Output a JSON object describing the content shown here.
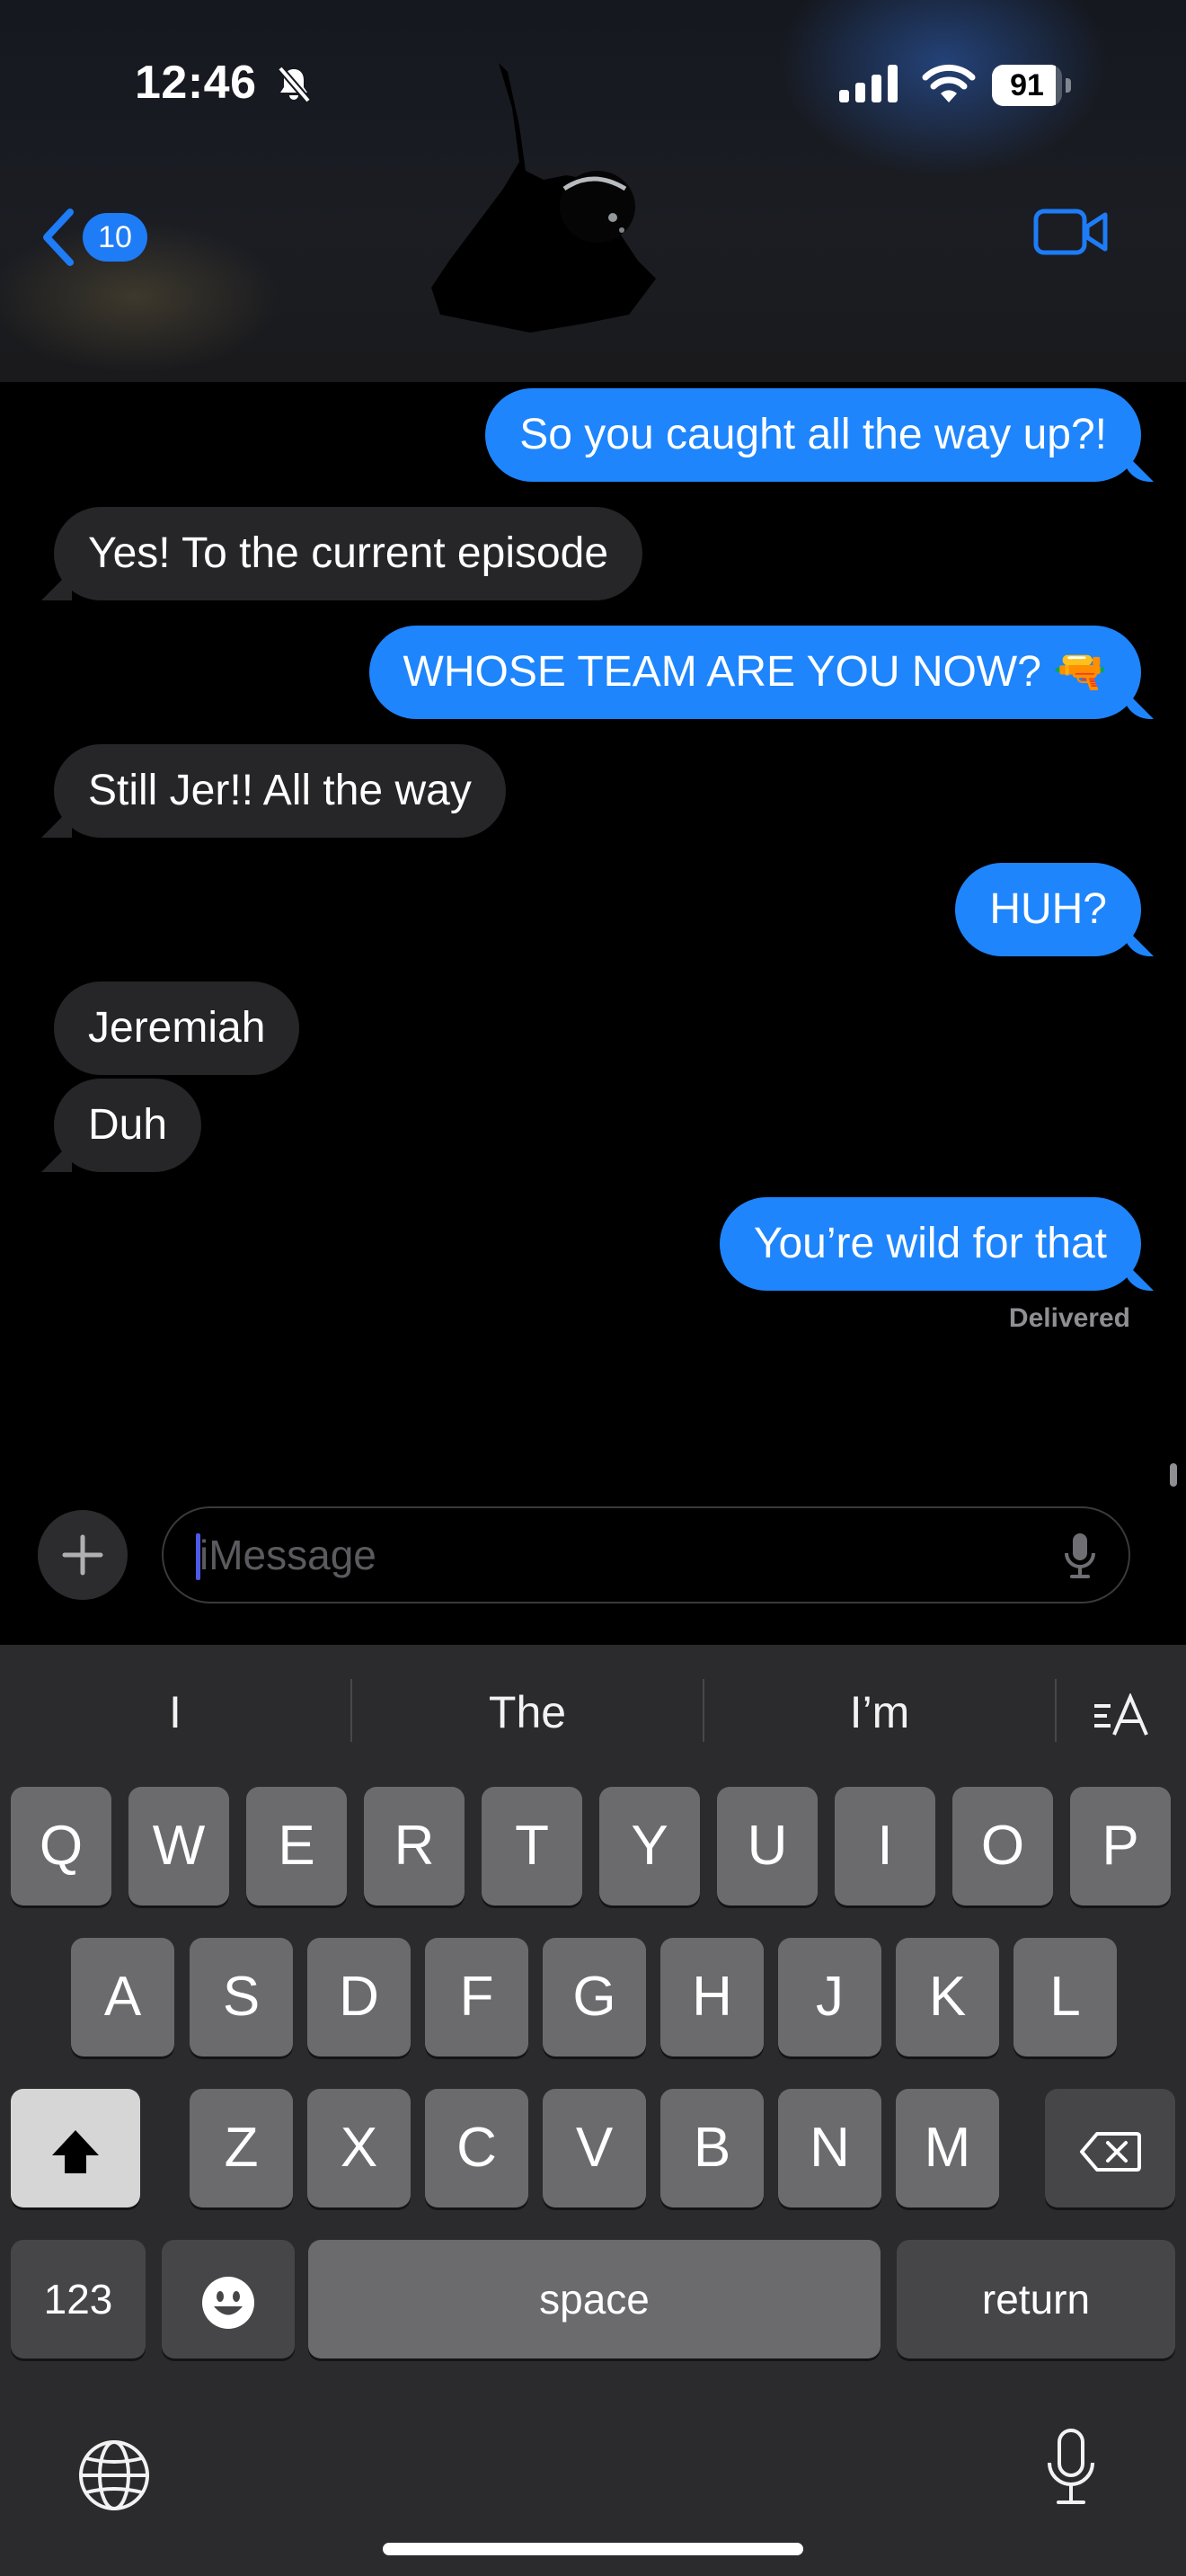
{
  "status_bar": {
    "time": "12:46",
    "battery_percent": "91",
    "battery_level": 0.91,
    "icons": [
      "bell-slash-icon",
      "cellular-signal-icon",
      "wifi-icon",
      "battery-icon"
    ]
  },
  "header": {
    "back_badge_count": "10",
    "icons": [
      "chevron-left-icon",
      "video-camera-icon"
    ]
  },
  "messages": [
    {
      "from": "me",
      "text": "So you caught all the way up?!"
    },
    {
      "from": "them",
      "text": "Yes! To the current episode"
    },
    {
      "from": "me",
      "text": "WHOSE TEAM ARE YOU NOW? 🔫"
    },
    {
      "from": "them",
      "text": "Still Jer!! All the way"
    },
    {
      "from": "me",
      "text": "HUH?"
    },
    {
      "from": "them",
      "text": "Jeremiah"
    },
    {
      "from": "them",
      "text": "Duh"
    },
    {
      "from": "me",
      "text": "You’re wild for that"
    }
  ],
  "delivery_status": "Delivered",
  "input": {
    "placeholder": "iMessage",
    "value": ""
  },
  "keyboard": {
    "suggestions": [
      "I",
      "The",
      "I’m"
    ],
    "row1": [
      "Q",
      "W",
      "E",
      "R",
      "T",
      "Y",
      "U",
      "I",
      "O",
      "P"
    ],
    "row2": [
      "A",
      "S",
      "D",
      "F",
      "G",
      "H",
      "J",
      "K",
      "L"
    ],
    "row3": [
      "Z",
      "X",
      "C",
      "V",
      "B",
      "N",
      "M"
    ],
    "numbers_label": "123",
    "space_label": "space",
    "return_label": "return"
  },
  "colors": {
    "sent_bubble": "#1e85fc",
    "received_bubble": "#262628",
    "accent": "#1e7cf6",
    "keyboard_bg": "#2b2b2d",
    "key": "#6b6b6e"
  }
}
